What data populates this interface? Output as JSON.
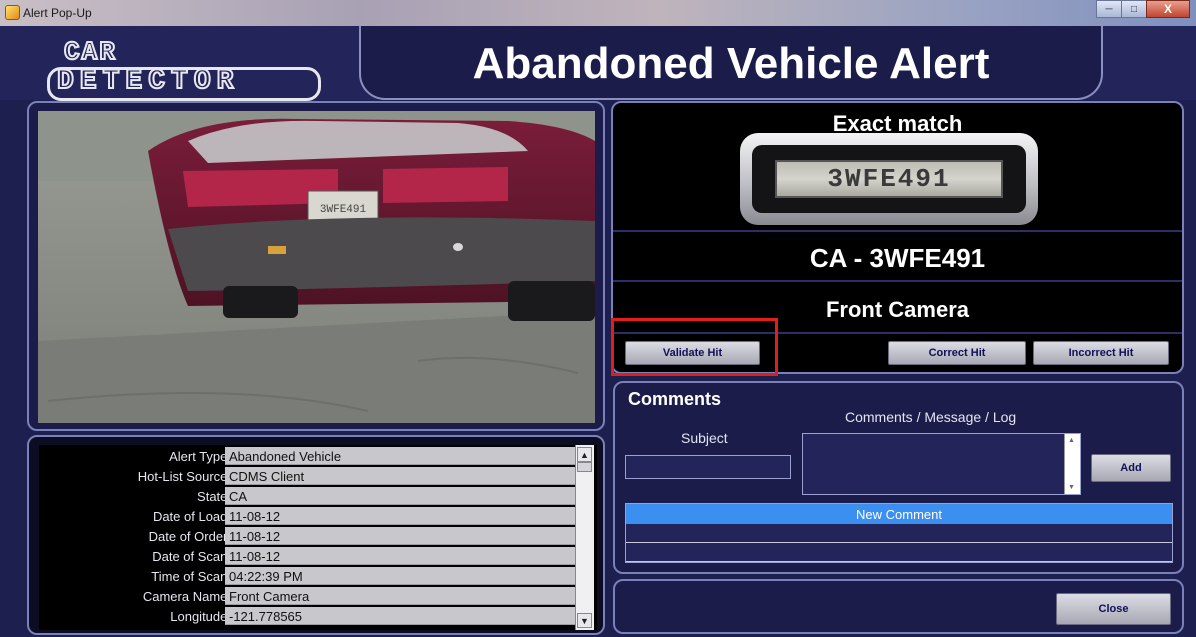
{
  "window": {
    "title": "Alert Pop-Up",
    "minimize_glyph": "─",
    "maximize_glyph": "□",
    "close_glyph": "X"
  },
  "logo": {
    "line1": "CAR",
    "line2": "DETECTOR"
  },
  "header": {
    "title": "Abandoned Vehicle Alert"
  },
  "details": [
    {
      "label": "Alert Type:",
      "value": "Abandoned Vehicle"
    },
    {
      "label": "Hot-List Source:",
      "value": "CDMS Client"
    },
    {
      "label": "State:",
      "value": "CA"
    },
    {
      "label": "Date of Load:",
      "value": "11-08-12"
    },
    {
      "label": "Date of Order:",
      "value": "11-08-12"
    },
    {
      "label": "Date of Scan:",
      "value": "11-08-12"
    },
    {
      "label": "Time of Scan:",
      "value": "04:22:39 PM"
    },
    {
      "label": "Camera Name:",
      "value": "Front Camera"
    },
    {
      "label": "Longitude:",
      "value": "-121.778565"
    }
  ],
  "plate": {
    "match_label": "Exact match",
    "plate_image_text": "3WFE491",
    "plate_number": "CA - 3WFE491",
    "camera": "Front Camera",
    "car_plate_text": "3WFE491"
  },
  "actions": {
    "validate": "Validate Hit",
    "correct": "Correct Hit",
    "incorrect": "Incorrect Hit"
  },
  "comments": {
    "title": "Comments",
    "log_label": "Comments / Message / Log",
    "subject_label": "Subject",
    "subject_value": "",
    "add_label": "Add",
    "list_header": "New Comment",
    "scroll_up_glyph": "▲",
    "scroll_down_glyph": "▼"
  },
  "footer": {
    "close_label": "Close"
  },
  "details_scroll": {
    "up_glyph": "▲",
    "down_glyph": "▼"
  },
  "colors": {
    "background": "#1d1f4e",
    "panel_border": "#7a80b8",
    "highlight": "#e01e1e",
    "selection": "#3b8ff0"
  }
}
